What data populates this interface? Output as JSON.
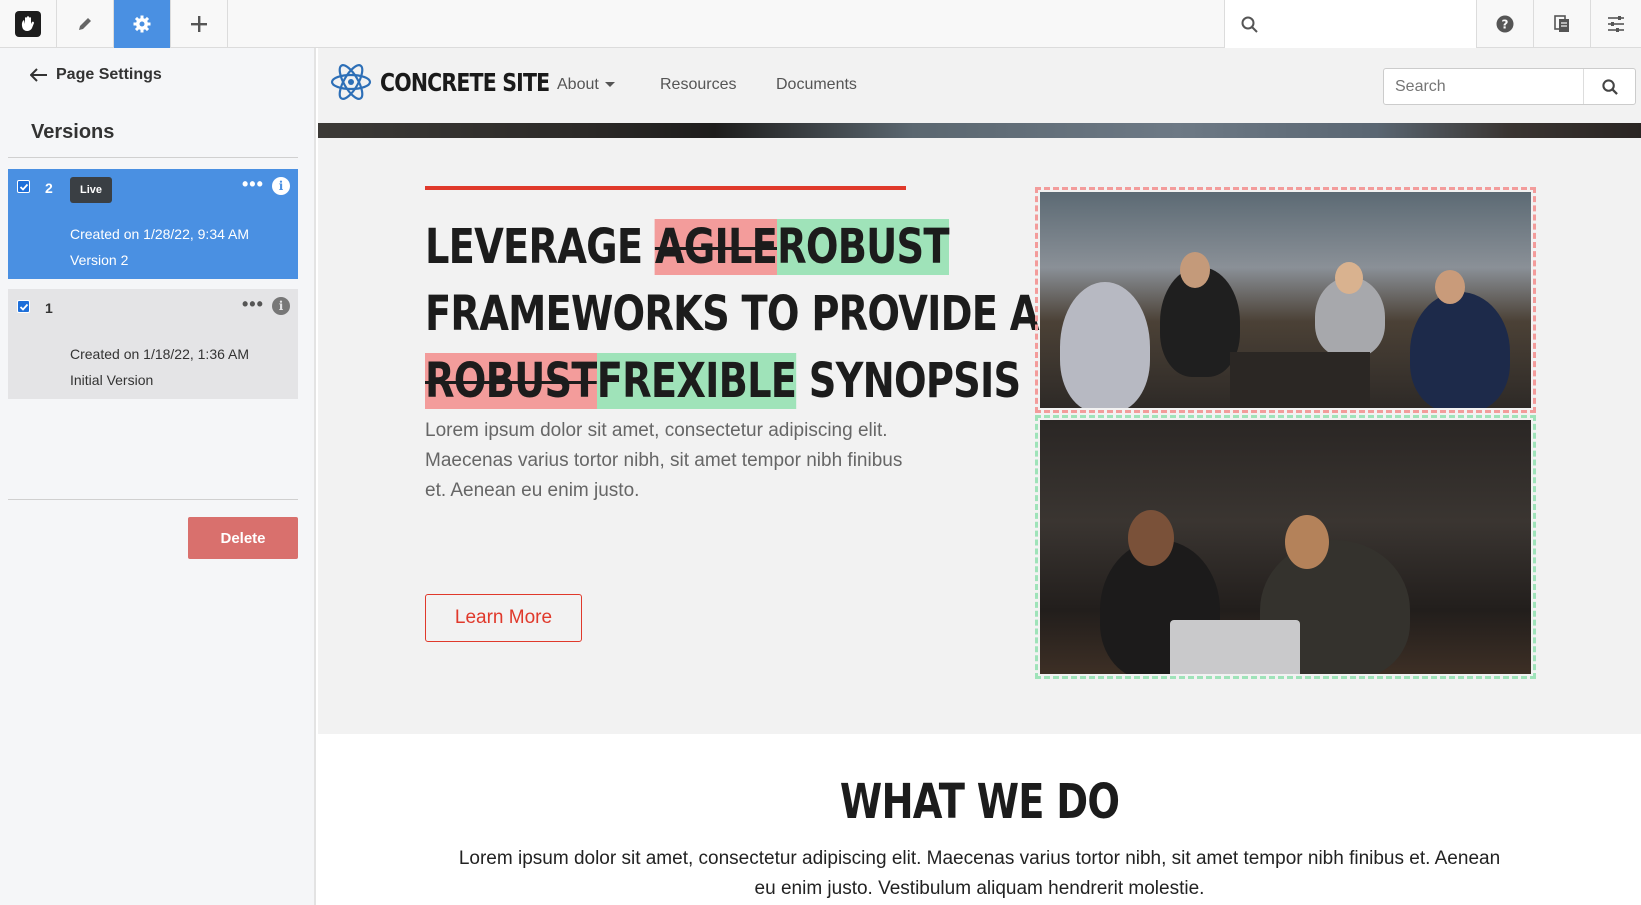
{
  "toolbar": {
    "logo_icon": "concrete-cms-hand-icon",
    "edit_icon": "pencil-icon",
    "settings_icon": "gear-icon",
    "add_icon": "plus-icon",
    "search_placeholder": "",
    "help_icon": "question-circle-icon",
    "sitemap_icon": "pages-icon",
    "options_icon": "sliders-icon",
    "active_color": "#4a90e2"
  },
  "sidebar": {
    "back_label": "Page Settings",
    "section_title": "Versions",
    "versions": [
      {
        "number": "2",
        "badge": "Live",
        "created": "Created on 1/28/22, 9:34 AM",
        "comment": "Version 2",
        "checked": true
      },
      {
        "number": "1",
        "badge": "",
        "created": "Created on 1/18/22, 1:36 AM",
        "comment": "Initial Version",
        "checked": true
      }
    ],
    "delete_label": "Delete",
    "delete_color": "#d9706d"
  },
  "site": {
    "brand": "CONCRETE SITE",
    "nav": [
      "About",
      "Resources",
      "Documents"
    ],
    "search_placeholder": "Search",
    "headline": {
      "w1": "LEVERAGE ",
      "removed1": "AGILE",
      "added1": "ROBUST",
      "line2": "FRAMEWORKS TO PROVIDE A",
      "removed2": "ROBUST",
      "added2": "FREXIBLE",
      "w2": " SYNOPSIS"
    },
    "body": "Lorem ipsum dolor sit amet, consectetur adipiscing elit. Maecenas varius tortor nibh, sit amet tempor nibh finibus et. Aenean eu enim justo.",
    "cta": "Learn More",
    "accent_color": "#e0392b",
    "diff_removed_color": "#f39c9b",
    "diff_added_color": "#9fe3b9",
    "section_title": "WHAT WE DO",
    "section_body": "Lorem ipsum dolor sit amet, consectetur adipiscing elit. Maecenas varius tortor nibh, sit amet tempor nibh finibus et. Aenean eu enim justo. Vestibulum aliquam hendrerit molestie."
  }
}
